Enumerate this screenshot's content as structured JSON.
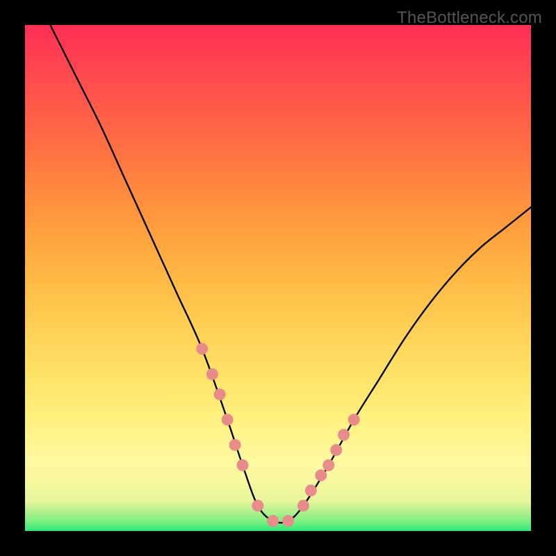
{
  "watermark": "TheBottleneck.com",
  "chart_data": {
    "type": "line",
    "title": "",
    "xlabel": "",
    "ylabel": "",
    "xlim": [
      0,
      100
    ],
    "ylim": [
      0,
      100
    ],
    "series": [
      {
        "name": "bottleneck-curve",
        "x": [
          5,
          10,
          15,
          20,
          25,
          30,
          35,
          40,
          43,
          46,
          49,
          52,
          55,
          60,
          65,
          70,
          75,
          80,
          85,
          90,
          95,
          100
        ],
        "values": [
          100,
          90,
          80,
          69,
          58,
          47,
          36,
          22,
          13,
          5,
          2,
          2,
          5,
          13,
          22,
          30,
          38,
          45,
          51,
          56,
          60,
          64
        ]
      }
    ],
    "markers": {
      "name": "highlight-points",
      "color": "#E88B8B",
      "x": [
        35,
        37,
        38.5,
        40,
        41.5,
        43,
        46,
        49,
        52,
        55,
        56.5,
        58.5,
        60,
        61.5,
        63,
        65
      ],
      "values": [
        36,
        31,
        27,
        22,
        17,
        13,
        5,
        2,
        2,
        5,
        8,
        11,
        13,
        16,
        19,
        22
      ]
    },
    "gradient_stops": [
      {
        "pct": 0,
        "color": "#2EE87A"
      },
      {
        "pct": 6,
        "color": "#E8F59A"
      },
      {
        "pct": 14,
        "color": "#FFF9A0"
      },
      {
        "pct": 40,
        "color": "#FFD055"
      },
      {
        "pct": 70,
        "color": "#FF8140"
      },
      {
        "pct": 100,
        "color": "#FF2E55"
      }
    ]
  }
}
